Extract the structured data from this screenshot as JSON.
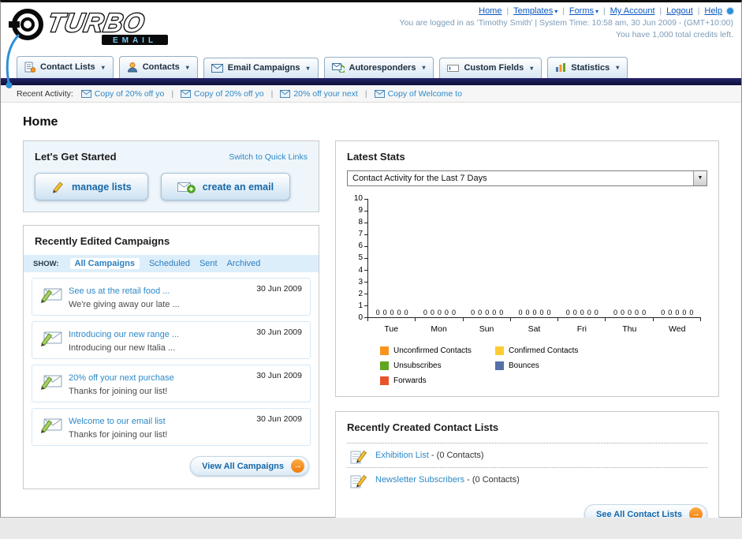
{
  "header": {
    "logo": {
      "primary": "TURBO",
      "secondary": "EMAIL"
    },
    "nav_links": [
      {
        "label": "Home",
        "dropdown": false
      },
      {
        "label": "Templates",
        "dropdown": true
      },
      {
        "label": "Forms",
        "dropdown": true
      },
      {
        "label": "My Account",
        "dropdown": false
      },
      {
        "label": "Logout",
        "dropdown": false
      },
      {
        "label": "Help",
        "dropdown": false
      }
    ],
    "session_info": "You are logged in as 'Timothy Smith' | System Time: 10:58 am, 30 Jun 2009 - (GMT+10:00)",
    "credits_info": "You have 1,000 total credits left."
  },
  "nav_tabs": [
    {
      "label": "Contact Lists",
      "icon": "contact-lists-icon"
    },
    {
      "label": "Contacts",
      "icon": "contacts-icon"
    },
    {
      "label": "Email Campaigns",
      "icon": "email-campaigns-icon"
    },
    {
      "label": "Autoresponders",
      "icon": "autoresponders-icon"
    },
    {
      "label": "Custom Fields",
      "icon": "custom-fields-icon"
    },
    {
      "label": "Statistics",
      "icon": "statistics-icon"
    }
  ],
  "recent_activity": {
    "label": "Recent Activity:",
    "items": [
      {
        "label": "Copy of 20% off yo",
        "icon": "email-icon"
      },
      {
        "label": "Copy of 20% off yo",
        "icon": "email-icon"
      },
      {
        "label": "20% off your next",
        "icon": "email-icon"
      },
      {
        "label": "Copy of Welcome to",
        "icon": "email-icon"
      }
    ]
  },
  "page_title": "Home",
  "get_started": {
    "title": "Let's Get Started",
    "switch_link": "Switch to Quick Links",
    "manage_lists_label": "manage lists",
    "create_email_label": "create an email"
  },
  "campaigns": {
    "title": "Recently Edited Campaigns",
    "show_label": "SHOW:",
    "filters": [
      "All Campaigns",
      "Scheduled",
      "Sent",
      "Archived"
    ],
    "active_filter": "All Campaigns",
    "items": [
      {
        "title": "See us at the retail food ...",
        "subtitle": "We're giving away our late ...",
        "date": "30 Jun 2009"
      },
      {
        "title": "Introducing our new range ...",
        "subtitle": "Introducing our new Italia ...",
        "date": "30 Jun 2009"
      },
      {
        "title": "20% off your next purchase",
        "subtitle": "Thanks for joining our list!",
        "date": "30 Jun 2009"
      },
      {
        "title": "Welcome to our email list",
        "subtitle": "Thanks for joining our list!",
        "date": "30 Jun 2009"
      }
    ],
    "view_all_label": "View All Campaigns"
  },
  "stats": {
    "title": "Latest Stats",
    "selector_value": "Contact Activity for the Last 7 Days",
    "chart_data": {
      "type": "bar",
      "categories": [
        "Tue",
        "Mon",
        "Sun",
        "Sat",
        "Fri",
        "Thu",
        "Wed"
      ],
      "series": [
        {
          "name": "Unconfirmed Contacts",
          "color": "#F7941E",
          "values": [
            0,
            0,
            0,
            0,
            0,
            0,
            0
          ]
        },
        {
          "name": "Confirmed Contacts",
          "color": "#FFCC33",
          "values": [
            0,
            0,
            0,
            0,
            0,
            0,
            0
          ]
        },
        {
          "name": "Unsubscribes",
          "color": "#61A621",
          "values": [
            0,
            0,
            0,
            0,
            0,
            0,
            0
          ]
        },
        {
          "name": "Bounces",
          "color": "#5470A8",
          "values": [
            0,
            0,
            0,
            0,
            0,
            0,
            0
          ]
        },
        {
          "name": "Forwards",
          "color": "#E8542A",
          "values": [
            0,
            0,
            0,
            0,
            0,
            0,
            0
          ]
        }
      ],
      "ylim": [
        0,
        10
      ],
      "ytick_step": 1,
      "grid": false,
      "legend_position": "bottom",
      "value_labels": true
    }
  },
  "contact_lists": {
    "title": "Recently Created Contact Lists",
    "items": [
      {
        "name": "Exhibition List",
        "detail": " - (0 Contacts)"
      },
      {
        "name": "Newsletter Subscribers",
        "detail": " - (0 Contacts)"
      }
    ],
    "see_all_label": "See All Contact Lists"
  }
}
